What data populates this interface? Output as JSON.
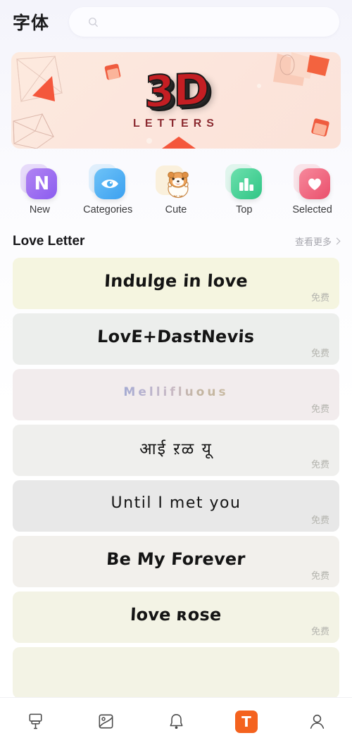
{
  "header": {
    "title": "字体",
    "search_placeholder": "",
    "search_value": "",
    "search_icon": "search-icon"
  },
  "banner": {
    "title": "3D",
    "subtitle": "LETTERS",
    "bg_color": "#fce6dc",
    "accent_color": "#c41e23"
  },
  "categories": [
    {
      "label": "New",
      "icon": "letter-n-icon",
      "color_start": "#a977ef",
      "color_end": "#8b5cf0",
      "glyph": "N"
    },
    {
      "label": "Categories",
      "icon": "eye-icon",
      "color_start": "#63bdf7",
      "color_end": "#3ba0f0",
      "glyph": ""
    },
    {
      "label": "Cute",
      "icon": "hamster-icon",
      "color_start": "#fde7b8",
      "color_end": "#fbdfa4",
      "glyph": ""
    },
    {
      "label": "Top",
      "icon": "bar-chart-icon",
      "color_start": "#63dba5",
      "color_end": "#36c98a",
      "glyph": ""
    },
    {
      "label": "Selected",
      "icon": "heart-icon",
      "color_start": "#f47e92",
      "color_end": "#ee5570",
      "glyph": ""
    }
  ],
  "section": {
    "title": "Love Letter",
    "more_label": "查看更多",
    "more_icon": "chevron-right-icon"
  },
  "font_cards": [
    {
      "sample": "Indulge in love",
      "price": "免费",
      "bg": "#f5f5e0",
      "style": "rounded"
    },
    {
      "sample": "LovE+DastNevis",
      "price": "免费",
      "bg": "#eceeec",
      "style": "rounded"
    },
    {
      "sample": "Mellifluous",
      "price": "免费",
      "bg": "#f2ecec",
      "style": "pastel"
    },
    {
      "sample": "आई ऱळ यू",
      "price": "免费",
      "bg": "#efefed",
      "style": "devanagari"
    },
    {
      "sample": "Until I met you",
      "price": "免费",
      "bg": "#e8e8e8",
      "style": "mono-thin"
    },
    {
      "sample": "Be My Forever",
      "price": "免费",
      "bg": "#f2f0ec",
      "style": "rounded"
    },
    {
      "sample": "love ʀose",
      "price": "免费",
      "bg": "#f3f3e5",
      "style": "rounded"
    },
    {
      "sample": "",
      "price": "",
      "bg": "#f3f3e5",
      "style": "rounded"
    }
  ],
  "bottom_nav": [
    {
      "icon": "paint-roller-icon",
      "active": false,
      "label": ""
    },
    {
      "icon": "wallpaper-image-icon",
      "active": false,
      "label": ""
    },
    {
      "icon": "bell-icon",
      "active": false,
      "label": ""
    },
    {
      "icon": "font-t-icon",
      "active": true,
      "label": "T"
    },
    {
      "icon": "user-profile-icon",
      "active": false,
      "label": ""
    }
  ],
  "colors": {
    "active_nav": "#f4621e",
    "page_bg": "#ffffff",
    "price_text": "#b4b4ae"
  }
}
